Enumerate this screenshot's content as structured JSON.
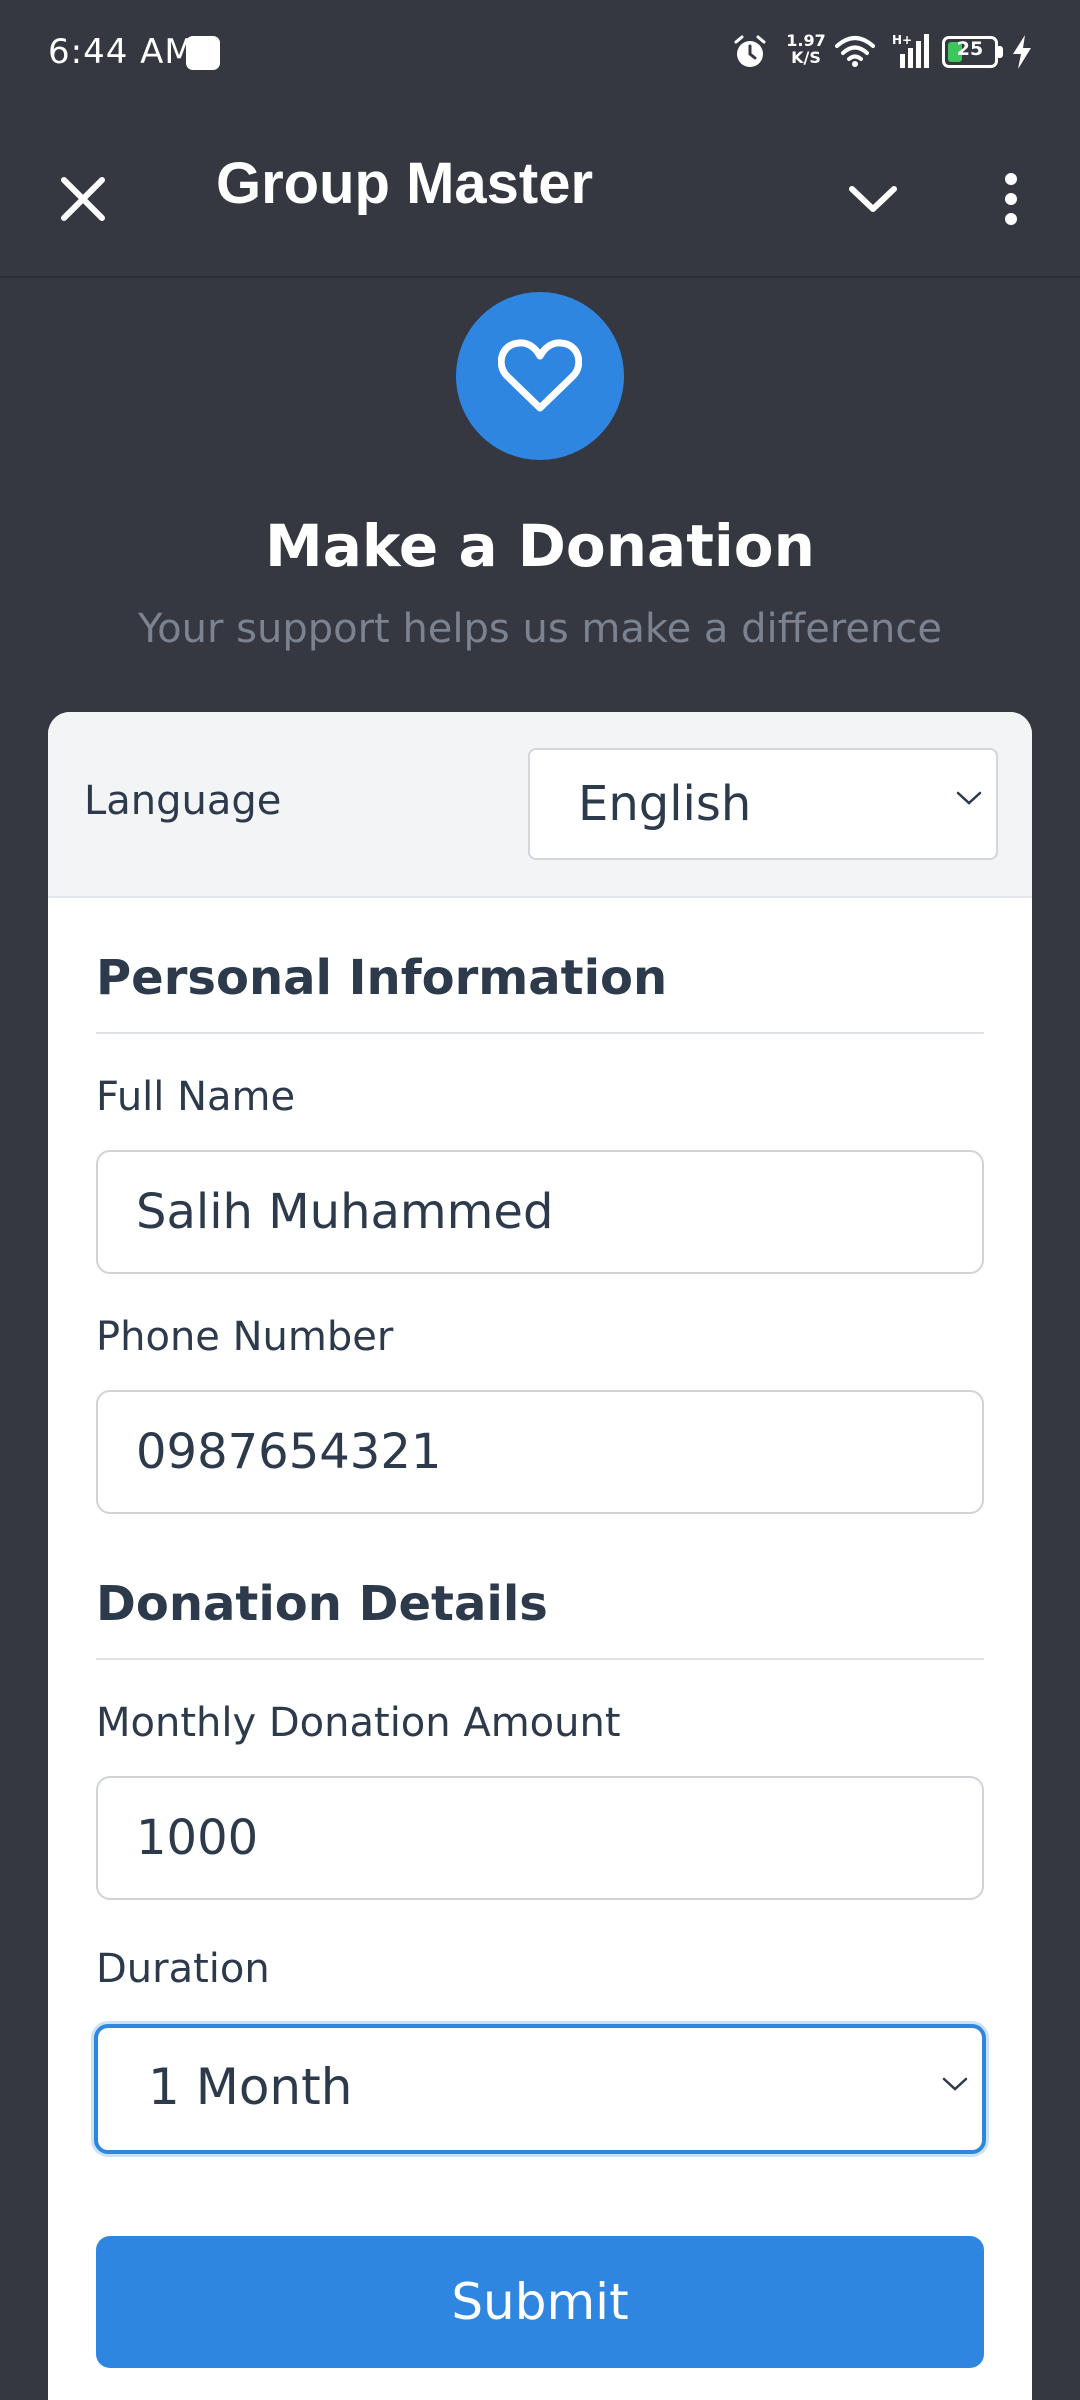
{
  "status_bar": {
    "time": "6:44 AM",
    "net_speed_value": "1.97",
    "net_speed_unit": "K/S",
    "battery_level": "25",
    "battery_color": "#3ec55b"
  },
  "app_bar": {
    "title": "Group Master",
    "icons": [
      "close-icon",
      "chevron-down-icon",
      "more-vertical-icon"
    ]
  },
  "hero": {
    "icon": "heart-icon",
    "accent": "#2f86e0",
    "title": "Make a Donation",
    "subtitle": "Your support helps us make a difference"
  },
  "language": {
    "label": "Language",
    "selected": "English"
  },
  "personal": {
    "heading": "Personal Information",
    "full_name_label": "Full Name",
    "full_name_value": "Salih Muhammed",
    "phone_label": "Phone Number",
    "phone_value": "0987654321"
  },
  "donation": {
    "heading": "Donation Details",
    "amount_label": "Monthly Donation Amount",
    "amount_value": "1000",
    "duration_label": "Duration",
    "duration_selected": "1 Month"
  },
  "submit_label": "Submit"
}
